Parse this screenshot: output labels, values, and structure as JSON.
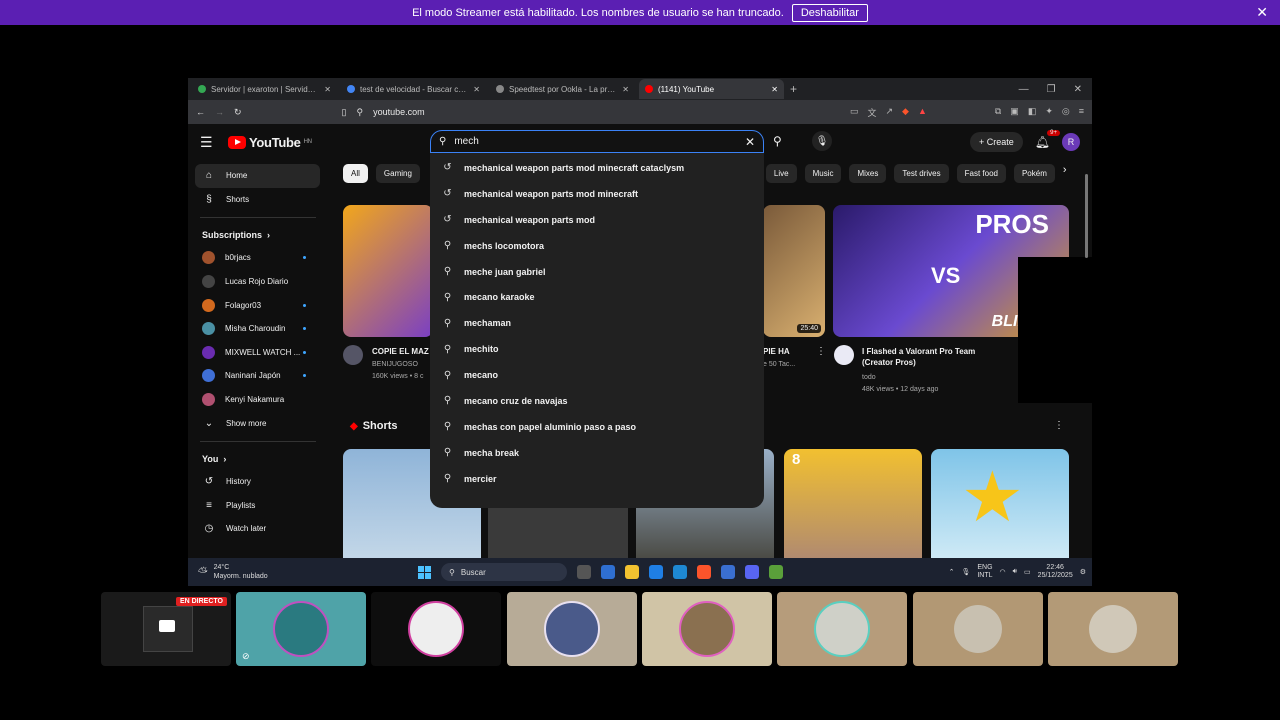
{
  "banner": {
    "message": "El modo Streamer está habilitado. Los nombres de usuario se han truncado.",
    "button": "Deshabilitar",
    "close": "✕"
  },
  "browser": {
    "tabs": [
      {
        "title": "Servidor | exaroton | Servidores de G",
        "color": "#34a853"
      },
      {
        "title": "test de velocidad - Buscar con Googl",
        "color": "#4285f4"
      },
      {
        "title": "Speedtest por Ookla - La prueba de",
        "color": "#888888"
      },
      {
        "title": "(1141) YouTube",
        "color": "#ff0000"
      }
    ],
    "new_tab": "+",
    "url": "youtube.com"
  },
  "youtube": {
    "logo_text": "YouTube",
    "region": "HN",
    "search_value": "mech",
    "create_label": "Create",
    "notif_count": "9+",
    "avatar_letter": "R",
    "sidebar": {
      "main": [
        {
          "label": "Home",
          "icon": "⌂"
        },
        {
          "label": "Shorts",
          "icon": "§"
        }
      ],
      "subscriptions_title": "Subscriptions",
      "subscriptions": [
        {
          "label": "b0rjacs",
          "color": "#a0522d",
          "live": true
        },
        {
          "label": "Lucas Rojo Diario",
          "color": "#444444",
          "live": false
        },
        {
          "label": "Folagor03",
          "color": "#d2691e",
          "live": true
        },
        {
          "label": "Misha Charoudin",
          "color": "#4a90a4",
          "live": true
        },
        {
          "label": "MIXWELL WATCH ...",
          "color": "#6a2cb0",
          "live": true
        },
        {
          "label": "Naninani Japón",
          "color": "#3f6fd6",
          "live": true
        },
        {
          "label": "Kenyi Nakamura",
          "color": "#b05070",
          "live": false
        }
      ],
      "show_more": "Show more",
      "you_title": "You",
      "you_items": [
        {
          "label": "History",
          "icon": "↺"
        },
        {
          "label": "Playlists",
          "icon": "≡"
        },
        {
          "label": "Watch later",
          "icon": "◷"
        }
      ]
    },
    "chips": [
      "All",
      "Gaming",
      "",
      "",
      "",
      "",
      "",
      "",
      "",
      "",
      "",
      "",
      "",
      "",
      "",
      "",
      "",
      "",
      "",
      "",
      "",
      "",
      "",
      "",
      "",
      "",
      "",
      "",
      "",
      "",
      "",
      ""
    ],
    "chips_right": [
      "Live",
      "Music",
      "Mixes",
      "Test drives",
      "Fast food",
      "Pokém"
    ],
    "videos": [
      {
        "title": "COPIE EL MAZ",
        "channel": "BENIJUGOSO",
        "meta": "160K views • 8 c"
      },
      {
        "title": "PIE HA",
        "channel": "",
        "meta": "e 50 Tac..."
      },
      {
        "title": "I Flashed a Valorant Pro Team (Creator Pros)",
        "channel": "todo",
        "meta": "48K views • 12 days ago"
      }
    ],
    "thumb_overlay": {
      "pros": "PROS",
      "vs": "VS",
      "blin": "BLIN"
    },
    "duration": "25:40",
    "shorts_title": "Shorts",
    "short_badge": "8",
    "suggestions": [
      {
        "text": "mechanical weapon parts mod minecraft cataclysm",
        "icon": "history"
      },
      {
        "text": "mechanical weapon parts mod minecraft",
        "icon": "history"
      },
      {
        "text": "mechanical weapon parts mod",
        "icon": "history"
      },
      {
        "text": "mechs locomotora",
        "icon": "search"
      },
      {
        "text": "meche juan gabriel",
        "icon": "search"
      },
      {
        "text": "mecano karaoke",
        "icon": "search"
      },
      {
        "text": "mechaman",
        "icon": "search"
      },
      {
        "text": "mechito",
        "icon": "search"
      },
      {
        "text": "mecano",
        "icon": "search"
      },
      {
        "text": "mecano cruz de navajas",
        "icon": "search"
      },
      {
        "text": "mechas con papel aluminio paso a paso",
        "icon": "search"
      },
      {
        "text": "mecha break",
        "icon": "search"
      },
      {
        "text": "mercier",
        "icon": "search"
      }
    ]
  },
  "taskbar": {
    "temp": "24°C",
    "weather": "Mayorm. nublado",
    "search": "Buscar",
    "lang1": "ENG",
    "lang2": "INTL",
    "time": "22:46",
    "date": "25/12/2025"
  },
  "participants": {
    "live_label": "EN DIRECTO"
  }
}
